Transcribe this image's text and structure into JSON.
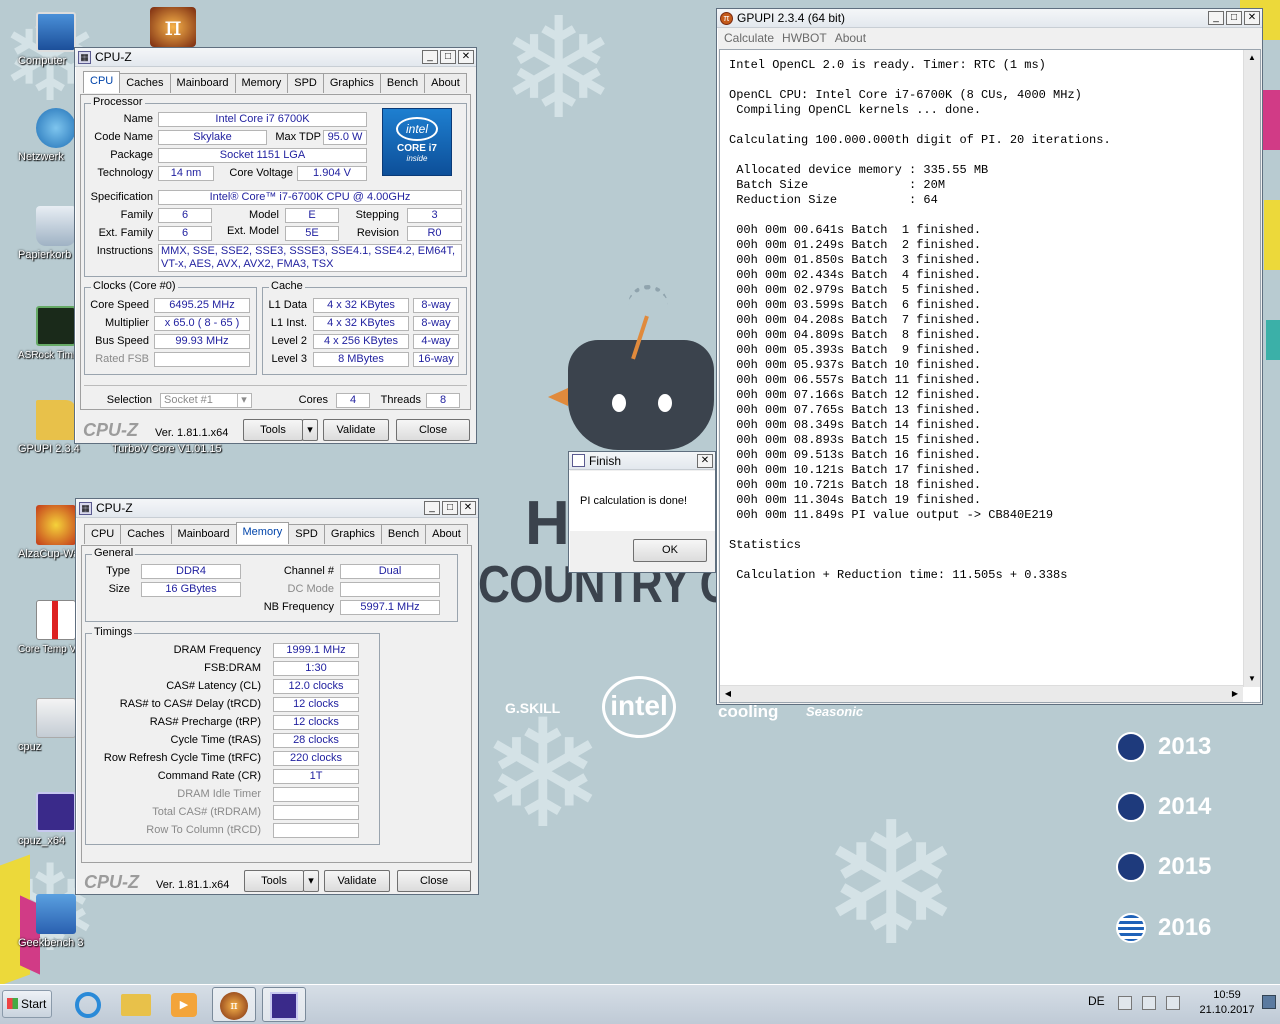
{
  "desktop": {
    "icons": [
      {
        "label": "Computer"
      },
      {
        "label": "Netzwerk"
      },
      {
        "label": "Papierkorb"
      },
      {
        "label": "ASRock Timing Configurator"
      },
      {
        "label": "GPUPI 2.3.4"
      },
      {
        "label": "TurboV Core V1.01.15"
      },
      {
        "label": "AlzaCup-Wallpaper"
      },
      {
        "label": "Core Temp Verknüpfung"
      },
      {
        "label": "cpuz"
      },
      {
        "label": "cpuz_x64"
      },
      {
        "label": "Geekbench 3"
      }
    ],
    "poster": {
      "partial_title": "H",
      "subtitle": "COUNTRY CUP",
      "years": [
        "2013",
        "2014",
        "2015",
        "2016"
      ],
      "sponsors": [
        "G.SKILL",
        "intel",
        "cooling",
        "Seasonic"
      ]
    }
  },
  "cpuz_cpu": {
    "title": "CPU-Z",
    "tabs": [
      "CPU",
      "Caches",
      "Mainboard",
      "Memory",
      "SPD",
      "Graphics",
      "Bench",
      "About"
    ],
    "processor": {
      "group": "Processor",
      "name_label": "Name",
      "name": "Intel Core i7 6700K",
      "codename_label": "Code Name",
      "codename": "Skylake",
      "maxtdp_label": "Max TDP",
      "maxtdp": "95.0 W",
      "package_label": "Package",
      "package": "Socket 1151 LGA",
      "technology_label": "Technology",
      "technology": "14 nm",
      "voltage_label": "Core Voltage",
      "voltage": "1.904 V",
      "spec_label": "Specification",
      "spec": "Intel® Core™ i7-6700K CPU @ 4.00GHz",
      "family_label": "Family",
      "family": "6",
      "model_label": "Model",
      "model": "E",
      "stepping_label": "Stepping",
      "stepping": "3",
      "extfamily_label": "Ext. Family",
      "extfamily": "6",
      "extmodel_label": "Ext. Model",
      "extmodel": "5E",
      "revision_label": "Revision",
      "revision": "R0",
      "instructions_label": "Instructions",
      "instructions": "MMX, SSE, SSE2, SSE3, SSSE3, SSE4.1, SSE4.2, EM64T, VT-x, AES, AVX, AVX2, FMA3, TSX",
      "logo_brand": "intel",
      "logo_line1": "CORE i7",
      "logo_line2": "inside"
    },
    "clocks": {
      "group": "Clocks (Core #0)",
      "corespeed_label": "Core Speed",
      "corespeed": "6495.25 MHz",
      "multiplier_label": "Multiplier",
      "multiplier": "x 65.0 ( 8 - 65 )",
      "busspeed_label": "Bus Speed",
      "busspeed": "99.93 MHz",
      "ratedfsb_label": "Rated FSB",
      "ratedfsb": ""
    },
    "cache": {
      "group": "Cache",
      "l1d_label": "L1 Data",
      "l1d": "4 x 32 KBytes",
      "l1d_way": "8-way",
      "l1i_label": "L1 Inst.",
      "l1i": "4 x 32 KBytes",
      "l1i_way": "8-way",
      "l2_label": "Level 2",
      "l2": "4 x 256 KBytes",
      "l2_way": "4-way",
      "l3_label": "Level 3",
      "l3": "8 MBytes",
      "l3_way": "16-way"
    },
    "selection_label": "Selection",
    "selection": "Socket #1",
    "cores_label": "Cores",
    "cores": "4",
    "threads_label": "Threads",
    "threads": "8",
    "logo": "CPU-Z",
    "version": "Ver. 1.81.1.x64",
    "tools": "Tools",
    "validate": "Validate",
    "close": "Close"
  },
  "cpuz_mem": {
    "title": "CPU-Z",
    "tabs": [
      "CPU",
      "Caches",
      "Mainboard",
      "Memory",
      "SPD",
      "Graphics",
      "Bench",
      "About"
    ],
    "general": {
      "group": "General",
      "type_label": "Type",
      "type": "DDR4",
      "size_label": "Size",
      "size": "16 GBytes",
      "channel_label": "Channel #",
      "channel": "Dual",
      "dcmode_label": "DC Mode",
      "dcmode": "",
      "nbfreq_label": "NB Frequency",
      "nbfreq": "5997.1 MHz"
    },
    "timings": {
      "group": "Timings",
      "rows": [
        {
          "label": "DRAM Frequency",
          "value": "1999.1 MHz",
          "disabled": false
        },
        {
          "label": "FSB:DRAM",
          "value": "1:30",
          "disabled": false
        },
        {
          "label": "CAS# Latency (CL)",
          "value": "12.0 clocks",
          "disabled": false
        },
        {
          "label": "RAS# to CAS# Delay (tRCD)",
          "value": "12 clocks",
          "disabled": false
        },
        {
          "label": "RAS# Precharge (tRP)",
          "value": "12 clocks",
          "disabled": false
        },
        {
          "label": "Cycle Time (tRAS)",
          "value": "28 clocks",
          "disabled": false
        },
        {
          "label": "Row Refresh Cycle Time (tRFC)",
          "value": "220 clocks",
          "disabled": false
        },
        {
          "label": "Command Rate (CR)",
          "value": "1T",
          "disabled": false
        },
        {
          "label": "DRAM Idle Timer",
          "value": "",
          "disabled": true
        },
        {
          "label": "Total CAS# (tRDRAM)",
          "value": "",
          "disabled": true
        },
        {
          "label": "Row To Column (tRCD)",
          "value": "",
          "disabled": true
        }
      ]
    },
    "logo": "CPU-Z",
    "version": "Ver. 1.81.1.x64",
    "tools": "Tools",
    "validate": "Validate",
    "close": "Close"
  },
  "finish": {
    "title": "Finish",
    "message": "PI calculation is done!",
    "ok": "OK"
  },
  "gpupi": {
    "title": "GPUPI 2.3.4 (64 bit)",
    "menu": [
      "Calculate",
      "HWBOT",
      "About"
    ],
    "output": [
      "Intel OpenCL 2.0 is ready. Timer: RTC (1 ms)",
      "",
      "OpenCL CPU: Intel Core i7-6700K (8 CUs, 4000 MHz)",
      " Compiling OpenCL kernels ... done.",
      "",
      "Calculating 100.000.000th digit of PI. 20 iterations.",
      "",
      " Allocated device memory : 335.55 MB",
      " Batch Size              : 20M",
      " Reduction Size          : 64",
      "",
      " 00h 00m 00.641s Batch  1 finished.",
      " 00h 00m 01.249s Batch  2 finished.",
      " 00h 00m 01.850s Batch  3 finished.",
      " 00h 00m 02.434s Batch  4 finished.",
      " 00h 00m 02.979s Batch  5 finished.",
      " 00h 00m 03.599s Batch  6 finished.",
      " 00h 00m 04.208s Batch  7 finished.",
      " 00h 00m 04.809s Batch  8 finished.",
      " 00h 00m 05.393s Batch  9 finished.",
      " 00h 00m 05.937s Batch 10 finished.",
      " 00h 00m 06.557s Batch 11 finished.",
      " 00h 00m 07.166s Batch 12 finished.",
      " 00h 00m 07.765s Batch 13 finished.",
      " 00h 00m 08.349s Batch 14 finished.",
      " 00h 00m 08.893s Batch 15 finished.",
      " 00h 00m 09.513s Batch 16 finished.",
      " 00h 00m 10.121s Batch 17 finished.",
      " 00h 00m 10.721s Batch 18 finished.",
      " 00h 00m 11.304s Batch 19 finished.",
      " 00h 00m 11.849s PI value output -> CB840E219",
      "",
      "Statistics",
      "",
      " Calculation + Reduction time: 11.505s + 0.338s"
    ]
  },
  "taskbar": {
    "start": "Start",
    "lang": "DE",
    "time": "10:59",
    "date": "21.10.2017"
  },
  "colors": {
    "desktop_bg": "#b8cbd1",
    "value_text": "#1f1f9f",
    "poster_dark": "#3b434d"
  }
}
